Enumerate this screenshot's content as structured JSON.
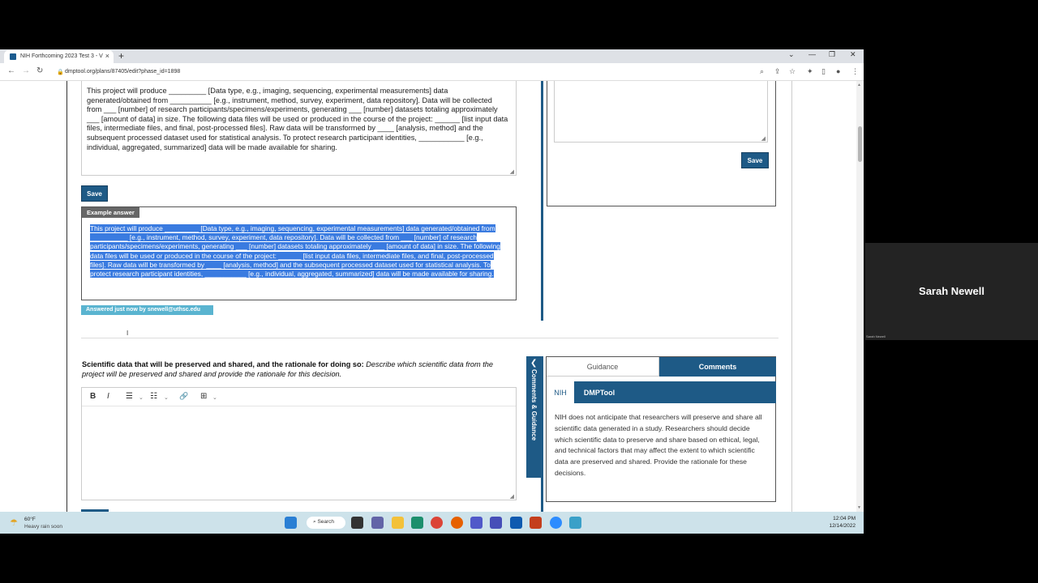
{
  "browser": {
    "tab_title": "NIH Forthcoming 2023 Test 3 - V",
    "tab_close": "×",
    "new_tab": "+",
    "url": "dmptool.org/plans/87405/edit?phase_id=1898",
    "window_controls": {
      "chevron": "⌄",
      "minimize": "—",
      "restore": "❐",
      "close": "✕"
    },
    "nav": {
      "back": "←",
      "forward": "→",
      "reload": "↻",
      "lock": "🔒"
    },
    "toolbar_icons": {
      "zoom": "⌕",
      "share": "⇪",
      "star": "☆",
      "extensions": "✦",
      "sidebar": "▯",
      "profile": "●",
      "menu": "⋮"
    }
  },
  "section1": {
    "answer_text": "This project will produce _________ [Data type, e.g., imaging, sequencing, experimental measurements] data generated/obtained from __________ [e.g., instrument, method, survey, experiment, data repository].  Data will be collected from  ___ [number] of research participants/specimens/experiments, generating ___ [number] datasets totaling approximately ___ [amount of data] in size. The following data files will be used or produced in the course of the project: ______ [list input data files, intermediate files, and final, post-processed files]. Raw data will be transformed by ____ [analysis, method] and the subsequent processed dataset used for statistical analysis. To protect research participant identities, ___________ [e.g., individual, aggregated, summarized] data will be made available for sharing.",
    "save_label": "Save",
    "example_header": "Example answer",
    "example_text": "This project will produce _________ [Data type, e.g., imaging, sequencing, experimental measurements] data generated/obtained from __________ [e.g., instrument, method, survey, experiment, data repository].  Data will be collected from  ___ [number] of research participants/specimens/experiments, generating ___ [number] datasets totaling approximately ___ [amount of data] in size. The following data files will be used or produced in the course of the project: ______ [list input data files, intermediate files, and final, post-processed files]. Raw data will be transformed by ____ [analysis, method] and the subsequent processed dataset used for statistical analysis. To protect research participant identities, ___________ [e.g., individual, aggregated, summarized] data will be made available for sharing.",
    "answered_badge": "Answered just now by snewell@uthsc.edu",
    "right_save_label": "Save"
  },
  "section2": {
    "question_bold": "Scientific data that will be preserved and shared, and the rationale for doing so:",
    "question_italic": "Describe which scientific data from the project will be preserved and shared and provide the rationale for this decision.",
    "toolbar": {
      "bold": "B",
      "italic": "I",
      "bullets": "☰",
      "numbers": "☷",
      "link": "🔗",
      "table": "⊞",
      "caret": "⌄"
    },
    "side_tab_label": "Comments & Guidance",
    "side_tab_chevron": "❮",
    "tabs": {
      "guidance": "Guidance",
      "comments": "Comments"
    },
    "subtabs": {
      "nih": "NIH",
      "dmptool": "DMPTool"
    },
    "guidance_text": "NIH does not anticipate that researchers will preserve and share all scientific data generated in a study. Researchers should decide which scientific data to preserve and share based on ethical, legal, and technical factors that may affect the extent to which scientific data are preserved and shared. Provide the rationale for these decisions."
  },
  "taskbar": {
    "weather_temp": "60°F",
    "weather_desc": "Heavy rain soon",
    "search_label": "Search",
    "time": "12:04 PM",
    "date": "12/14/2022"
  },
  "video": {
    "participant_name": "Sarah Newell",
    "participant_small": "Sarah Newell"
  }
}
